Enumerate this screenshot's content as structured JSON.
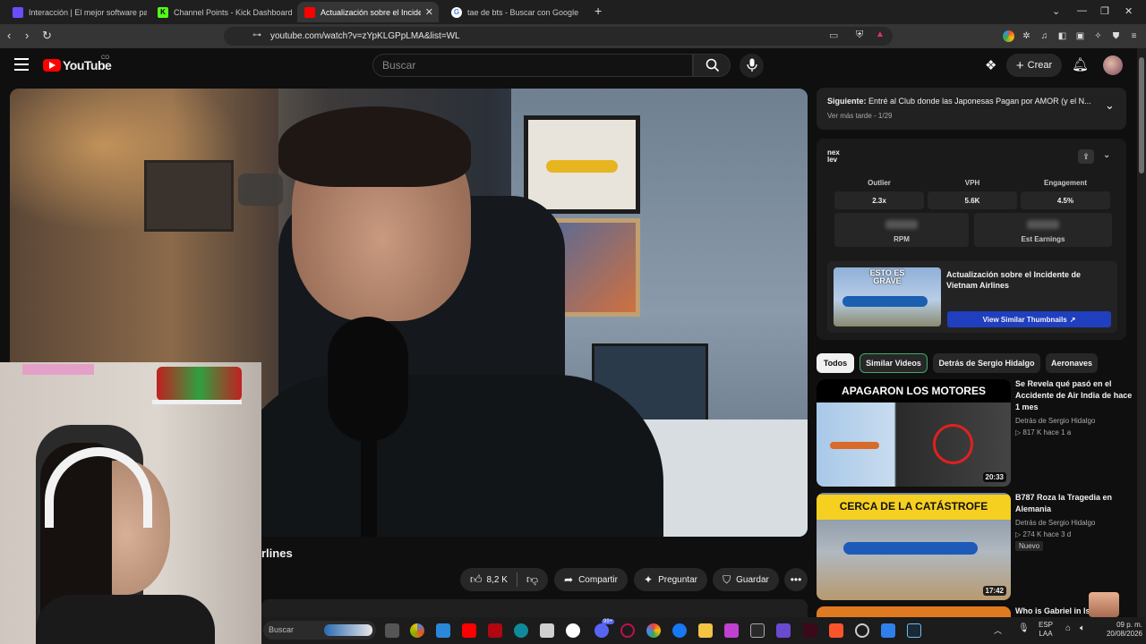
{
  "browser": {
    "tabs": [
      {
        "title": "Interacción | El mejor software para p"
      },
      {
        "title": "Channel Points - Kick Dashboard"
      },
      {
        "title": "Actualización sobre el Incidente"
      },
      {
        "title": "tae de bts - Buscar con Google"
      }
    ],
    "url": "youtube.com/watch?v=zYpKLGPpLMA&list=WL"
  },
  "youtube": {
    "logo_text": "YouTube",
    "country": "CO",
    "search_placeholder": "Buscar",
    "create_label": "Crear"
  },
  "video": {
    "title_fragment": "rlines",
    "likes": "8,2 K",
    "share_label": "Compartir",
    "ask_label": "Preguntar",
    "save_label": "Guardar"
  },
  "up_next": {
    "prefix": "Siguiente:",
    "title": "Entré al Club donde las Japonesas Pagan por AMOR (y el N...",
    "sub": "Ver más tarde - 1/29"
  },
  "nexlev": {
    "logo_text": "nex lev",
    "metrics": [
      {
        "label": "Outlier",
        "value": "2.3x"
      },
      {
        "label": "VPH",
        "value": "5.6K"
      },
      {
        "label": "Engagement",
        "value": "4.5%"
      }
    ],
    "hidden_metrics": [
      {
        "label": "RPM"
      },
      {
        "label": "Est Earnings"
      }
    ],
    "thumb_text": "ESTO ES GRAVE",
    "video_title": "Actualización sobre el Incidente de Vietnam Airlines",
    "similar_button": "View Similar Thumbnails"
  },
  "chips": [
    "Todos",
    "Similar Videos",
    "Detrás de Sergio Hidalgo",
    "Aeronaves"
  ],
  "related": [
    {
      "thumb_text": "APAGARON LOS MOTORES",
      "duration": "20:33",
      "title": "Se Revela qué pasó en el Accidente de Air India de hace 1 mes",
      "channel": "Detrás de Sergio Hidalgo",
      "stats": "817 K  hace 1 a"
    },
    {
      "thumb_text": "CERCA DE LA CATÁSTROFE",
      "duration": "17:42",
      "title": "B787 Roza la Tragedia en Alemania",
      "channel": "Detrás de Sergio Hidalgo",
      "stats": "274 K  hace 3 d",
      "badge": "Nuevo"
    },
    {
      "title": "Who is Gabriel in Isl"
    }
  ],
  "taskbar": {
    "search_placeholder": "Buscar",
    "lang": "ESP",
    "lang2": "LAA",
    "time": "09 p. m.",
    "date": "20/08/2026",
    "notif_badge": "99+"
  }
}
